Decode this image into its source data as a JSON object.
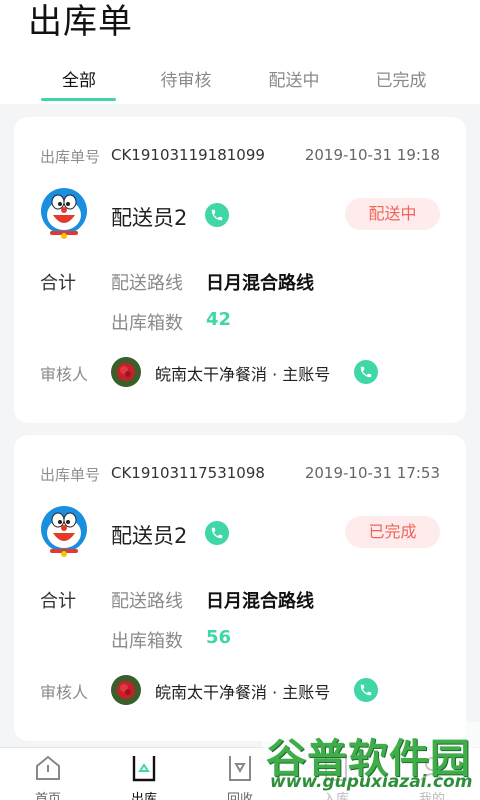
{
  "page": {
    "title": "出库单"
  },
  "tabs": [
    {
      "label": "全部",
      "active": true
    },
    {
      "label": "待审核",
      "active": false
    },
    {
      "label": "配送中",
      "active": false
    },
    {
      "label": "已完成",
      "active": false
    }
  ],
  "colors": {
    "accent": "#3fd6a8",
    "status_text": "#f0645a",
    "status_bg": "#fdeceb"
  },
  "orders": [
    {
      "order_label": "出库单号",
      "order_no": "CK19103119181099",
      "time": "2019-10-31 19:18",
      "courier": "配送员2",
      "status": "配送中",
      "summary_label": "合计",
      "route_label": "配送路线",
      "route": "日月混合路线",
      "boxes_label": "出库箱数",
      "boxes": "42",
      "reviewer_label": "审核人",
      "reviewer": "皖南太干净餐消 · 主账号"
    },
    {
      "order_label": "出库单号",
      "order_no": "CK19103117531098",
      "time": "2019-10-31 17:53",
      "courier": "配送员2",
      "status": "已完成",
      "summary_label": "合计",
      "route_label": "配送路线",
      "route": "日月混合路线",
      "boxes_label": "出库箱数",
      "boxes": "56",
      "reviewer_label": "审核人",
      "reviewer": "皖南太干净餐消 · 主账号"
    }
  ],
  "bottom_nav": [
    {
      "label": "首页",
      "icon": "home-icon"
    },
    {
      "label": "出库",
      "icon": "outbound-icon",
      "active": true
    },
    {
      "label": "回收",
      "icon": "recycle-icon"
    },
    {
      "label": "入库",
      "icon": "inbound-icon"
    },
    {
      "label": "我的",
      "icon": "profile-icon"
    }
  ],
  "watermark": {
    "title": "谷普软件园",
    "url": "www.gupuxiazai.com"
  }
}
